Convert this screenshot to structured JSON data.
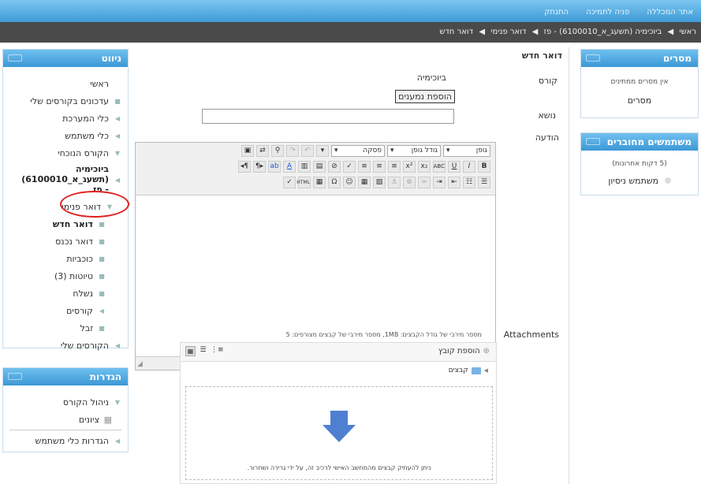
{
  "top_links": [
    "אתר המכללה",
    "פניה לתמיכה",
    "התנתק"
  ],
  "breadcrumb": [
    "ראשי",
    "ביוכימיה (תשעג_א_6100010) - פז",
    "דואר פנימי",
    "דואר חדש"
  ],
  "nav_block": {
    "title": "ניווט",
    "items": [
      {
        "label": "ראשי",
        "marker": ""
      },
      {
        "label": "עדכונים בקורסים שלי",
        "marker": "■"
      },
      {
        "label": "כלי המערכת",
        "marker": "◀"
      },
      {
        "label": "כלי משתמש",
        "marker": "◀"
      },
      {
        "label": "הקורס הנוכחי",
        "marker": "▼"
      }
    ],
    "course": {
      "line1": "ביוכימיה",
      "line2": "(תשעג_א_6100010)",
      "line3": "- פז"
    },
    "sub_items": [
      {
        "label": "דואר פנימי",
        "marker": "▼"
      },
      {
        "label": "דואר חדש",
        "marker": "■"
      },
      {
        "label": "דואר נכנס",
        "marker": "■"
      },
      {
        "label": "כוכביות",
        "marker": "■"
      },
      {
        "label": "טיוטות (3)",
        "marker": "■"
      },
      {
        "label": "נשלח",
        "marker": "■"
      },
      {
        "label": "קורסים",
        "marker": "◀"
      },
      {
        "label": "זבל",
        "marker": "■"
      },
      {
        "label": "הקורסים שלי",
        "marker": "◀"
      }
    ]
  },
  "settings_block": {
    "title": "הגדרות",
    "items": [
      {
        "label": "ניהול הקורס",
        "marker": "▼"
      },
      {
        "label": "ציונים",
        "marker": "▦"
      },
      {
        "label": "הגדרות כלי משתמש",
        "marker": "◀"
      }
    ]
  },
  "teachers_block": {
    "title": "מסרים",
    "empty_text": "אין מסרים ממתינים",
    "link": "מסרים"
  },
  "online_block": {
    "title": "משתמשים מחוברים",
    "subtitle": "(5 דקות אחרונות)",
    "user": "משתמש ניסיון"
  },
  "form": {
    "heading": "דואר חדש",
    "course_label": "קורס",
    "course_value": "ביוכימיה",
    "add_recipients_button": "הוספת נמענים",
    "subject_label": "נושא",
    "message_label": "הודעה",
    "attachments_label": "Attachments",
    "attachments_limits": "מספר מירבי של גודל הקבצים: 1MB, מספר מירבי של קבצים מצורפים: 5"
  },
  "editor": {
    "font_select": "גופן",
    "size_select": "גודל גופן",
    "para_select": "פסקה"
  },
  "filepicker": {
    "add_file": "הוספת קובץ",
    "folder": "קבצים",
    "drop_hint": "ניתן להעתיק קבצים מהמחשב האישי לרכיב זה, על ידי גרירה ושחרור."
  }
}
